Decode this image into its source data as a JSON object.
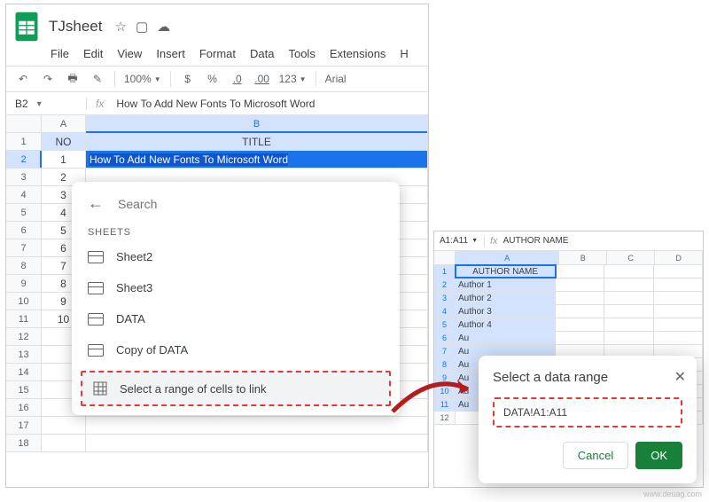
{
  "left": {
    "doc_title": "TJsheet",
    "menu": [
      "File",
      "Edit",
      "View",
      "Insert",
      "Format",
      "Data",
      "Tools",
      "Extensions",
      "H"
    ],
    "toolbar": {
      "zoom": "100%",
      "font": "Arial",
      "percent": "%",
      "currency": "$",
      "dec0": ".0",
      "dec00": ".00",
      "num": "123"
    },
    "namebox": "B2",
    "formula": "How To Add New Fonts To Microsoft Word",
    "columns": [
      "A",
      "B"
    ],
    "header_row": {
      "a": "NO",
      "b": "TITLE"
    },
    "rows": [
      {
        "n": "1",
        "a": "1",
        "b": "How To Add New Fonts To Microsoft Word"
      },
      {
        "n": "2",
        "a": "2",
        "b": ""
      },
      {
        "n": "3",
        "a": "3",
        "b": ""
      },
      {
        "n": "4",
        "a": "4",
        "b": ""
      },
      {
        "n": "5",
        "a": "5",
        "b": ""
      },
      {
        "n": "6",
        "a": "6",
        "b": ""
      },
      {
        "n": "7",
        "a": "7",
        "b": ""
      },
      {
        "n": "8",
        "a": "8",
        "b": ""
      },
      {
        "n": "9",
        "a": "9",
        "b": ""
      },
      {
        "n": "10",
        "a": "10",
        "b": ""
      }
    ],
    "popover": {
      "search_placeholder": "Search",
      "section": "SHEETS",
      "items": [
        "Sheet2",
        "Sheet3",
        "DATA",
        "Copy of DATA"
      ],
      "range_link": "Select a range of cells to link"
    }
  },
  "right": {
    "namebox": "A1:A11",
    "formula": "AUTHOR NAME",
    "columns": [
      "A",
      "B",
      "C",
      "D"
    ],
    "rows": [
      {
        "n": "1",
        "a": "AUTHOR NAME"
      },
      {
        "n": "2",
        "a": "Author 1"
      },
      {
        "n": "3",
        "a": "Author 2"
      },
      {
        "n": "4",
        "a": "Author 3"
      },
      {
        "n": "5",
        "a": "Author 4"
      },
      {
        "n": "6",
        "a": "Au"
      },
      {
        "n": "7",
        "a": "Au"
      },
      {
        "n": "8",
        "a": "Au"
      },
      {
        "n": "9",
        "a": "Au"
      },
      {
        "n": "10",
        "a": "Au"
      },
      {
        "n": "11",
        "a": "Au"
      },
      {
        "n": "12",
        "a": ""
      }
    ],
    "modal": {
      "title": "Select a data range",
      "input": "DATA!A1:A11",
      "cancel": "Cancel",
      "ok": "OK"
    }
  },
  "watermark": "www.deuag.com"
}
